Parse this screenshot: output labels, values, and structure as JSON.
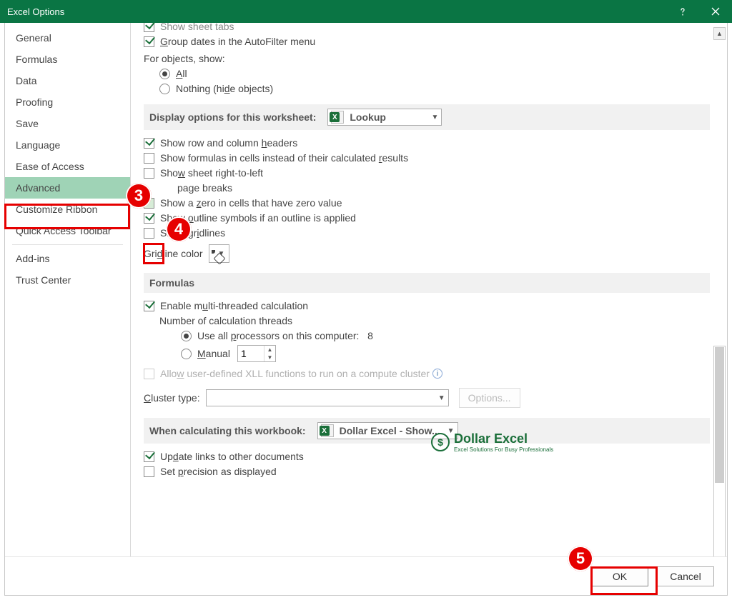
{
  "titlebar": {
    "title": "Excel Options"
  },
  "sidebar": {
    "items": [
      {
        "label": "General"
      },
      {
        "label": "Formulas"
      },
      {
        "label": "Data"
      },
      {
        "label": "Proofing"
      },
      {
        "label": "Save"
      },
      {
        "label": "Language"
      },
      {
        "label": "Ease of Access"
      },
      {
        "label": "Advanced",
        "selected": true
      },
      {
        "label": "Customize Ribbon"
      },
      {
        "label": "Quick Access Toolbar"
      },
      {
        "label": "Add-ins"
      },
      {
        "label": "Trust Center"
      }
    ]
  },
  "content": {
    "top": {
      "show_sheet_tabs": "Show sheet tabs",
      "group_dates": "Group dates in the AutoFilter menu",
      "for_objects": "For objects, show:",
      "all": "All",
      "nothing": "Nothing (hide objects)"
    },
    "display_worksheet": {
      "header": "Display options for this worksheet:",
      "sheet": "Lookup",
      "show_headers": "Show row and column headers",
      "show_formulas": "Show formulas in cells instead of their calculated results",
      "rtl": "Show sheet right-to-left",
      "page_breaks": "page breaks",
      "zero": "Show a zero in cells that have zero value",
      "outline": "Show outline symbols if an outline is applied",
      "gridlines": "Show gridlines",
      "gridline_color": "Gridline color"
    },
    "formulas": {
      "header": "Formulas",
      "multi": "Enable multi-threaded calculation",
      "threads_label": "Number of calculation threads",
      "use_all": "Use all processors on this computer:",
      "use_all_count": "8",
      "manual": "Manual",
      "manual_value": "1",
      "xll": "Allow user-defined XLL functions to run on a compute cluster",
      "cluster_type": "Cluster type:",
      "options_btn": "Options..."
    },
    "calc_workbook": {
      "header": "When calculating this workbook:",
      "book": "Dollar Excel - Show...",
      "update_links": "Update links to other documents",
      "precision": "Set precision as displayed"
    }
  },
  "logo": {
    "main": "Dollar Excel",
    "sub": "Excel Solutions For Busy Professionals"
  },
  "footer": {
    "ok": "OK",
    "cancel": "Cancel"
  },
  "callouts": {
    "c3": "3",
    "c4": "4",
    "c5": "5"
  }
}
